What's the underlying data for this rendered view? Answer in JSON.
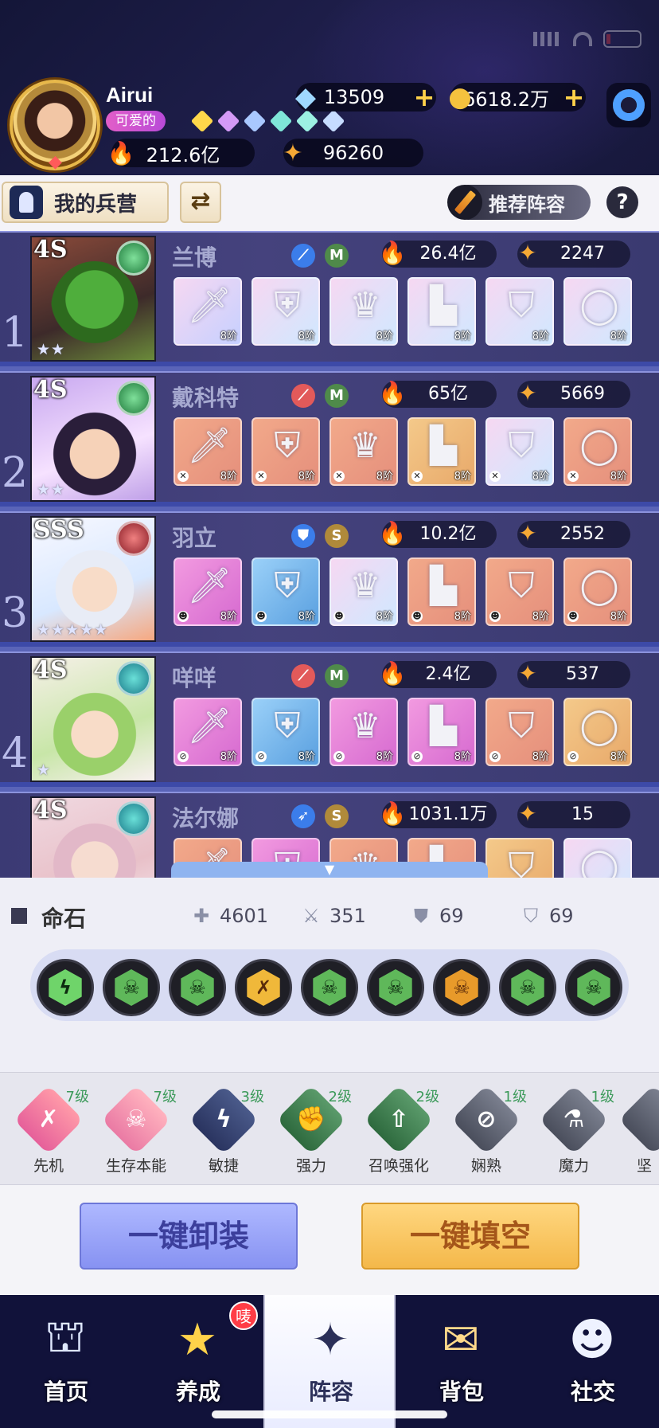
{
  "player": {
    "name": "Airui",
    "tag": "可爱的",
    "power": "212.6亿",
    "points": "96260",
    "diamonds": "13509",
    "gold": "6618.2万"
  },
  "colors": {
    "accent_blue": "#3d4aa8",
    "gold": "#ffd24a",
    "green_level": "#3c9a5a",
    "fire": "#ff5a2a"
  },
  "toolbar": {
    "barracks_label": "我的兵营",
    "recommend_label": "推荐阵容",
    "help_label": "?"
  },
  "heroes": [
    {
      "index": "1",
      "rank": "4S",
      "name": "兰博",
      "role_badge": "M",
      "power": "26.4亿",
      "points": "2247",
      "stars": "★★",
      "gear": [
        {
          "icon": "sword",
          "level": "8阶"
        },
        {
          "icon": "armor",
          "level": "8阶"
        },
        {
          "icon": "helmet",
          "level": "8阶"
        },
        {
          "icon": "boots",
          "level": "8阶"
        },
        {
          "icon": "emblem",
          "level": "8阶"
        },
        {
          "icon": "ring",
          "level": "8阶"
        }
      ]
    },
    {
      "index": "2",
      "rank": "4S",
      "name": "戴科特",
      "role_badge": "M",
      "power": "65亿",
      "points": "5669",
      "stars": "★★",
      "gear": [
        {
          "icon": "sword",
          "level": "8阶"
        },
        {
          "icon": "armor",
          "level": "8阶"
        },
        {
          "icon": "helmet",
          "level": "8阶"
        },
        {
          "icon": "boots",
          "level": "8阶"
        },
        {
          "icon": "emblem",
          "level": "8阶"
        },
        {
          "icon": "ring",
          "level": "8阶"
        }
      ]
    },
    {
      "index": "3",
      "rank": "SSS",
      "name": "羽立",
      "role_badge": "S",
      "power": "10.2亿",
      "points": "2552",
      "stars": "★★★★★",
      "gear": [
        {
          "icon": "sword",
          "level": "8阶"
        },
        {
          "icon": "armor",
          "level": "8阶"
        },
        {
          "icon": "helmet",
          "level": "8阶"
        },
        {
          "icon": "boots",
          "level": "8阶"
        },
        {
          "icon": "emblem",
          "level": "8阶"
        },
        {
          "icon": "ring",
          "level": "8阶"
        }
      ]
    },
    {
      "index": "4",
      "rank": "4S",
      "name": "咩咩",
      "role_badge": "M",
      "power": "2.4亿",
      "points": "537",
      "stars": "★",
      "gear": [
        {
          "icon": "sword",
          "level": "8阶"
        },
        {
          "icon": "armor",
          "level": "8阶"
        },
        {
          "icon": "helmet",
          "level": "8阶"
        },
        {
          "icon": "boots",
          "level": "8阶"
        },
        {
          "icon": "emblem",
          "level": "8阶"
        },
        {
          "icon": "ring",
          "level": "8阶"
        }
      ]
    },
    {
      "index": "",
      "rank": "4S",
      "name": "法尔娜",
      "role_badge": "S",
      "power": "1031.1万",
      "points": "15",
      "stars": "",
      "gear": [
        {
          "icon": "sword",
          "level": ""
        },
        {
          "icon": "armor",
          "level": ""
        },
        {
          "icon": "helmet",
          "level": ""
        },
        {
          "icon": "boots",
          "level": ""
        },
        {
          "icon": "emblem",
          "level": ""
        },
        {
          "icon": "ring",
          "level": ""
        }
      ]
    }
  ],
  "stone_panel": {
    "title": "命石",
    "stats": {
      "hp": "4601",
      "attack": "351",
      "defense": "69",
      "magic_defense": "69"
    },
    "gems": [
      "lightning-gem-green",
      "skull-gem-green",
      "skull-gem-green",
      "sword-gem-gold",
      "skull-gem-green",
      "skull-gem-green",
      "skull-gem-gold",
      "skull-gem-green",
      "skull-gem-green"
    ]
  },
  "traits": [
    {
      "label": "先机",
      "level": "7级"
    },
    {
      "label": "生存本能",
      "level": "7级"
    },
    {
      "label": "敏捷",
      "level": "3级"
    },
    {
      "label": "强力",
      "level": "2级"
    },
    {
      "label": "召唤强化",
      "level": "2级"
    },
    {
      "label": "娴熟",
      "level": "1级"
    },
    {
      "label": "魔力",
      "level": "1级"
    },
    {
      "label": "坚",
      "level": ""
    }
  ],
  "actions": {
    "unequip_label": "一键卸装",
    "fill_label": "一键填空"
  },
  "nav": {
    "items": [
      {
        "label": "首页"
      },
      {
        "label": "养成",
        "badge": "唛"
      },
      {
        "label": "阵容"
      },
      {
        "label": "背包"
      },
      {
        "label": "社交"
      }
    ]
  }
}
